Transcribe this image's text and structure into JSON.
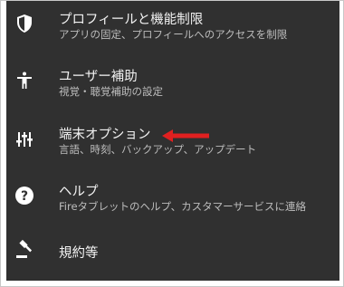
{
  "settings_list": {
    "items": [
      {
        "icon": "shield-icon",
        "title": "プロフィールと機能制限",
        "subtitle": "アプリの固定、プロフィールへのアクセスを制限"
      },
      {
        "icon": "accessibility-icon",
        "title": "ユーザー補助",
        "subtitle": "視覚・聴覚補助の設定"
      },
      {
        "icon": "sliders-icon",
        "title": "端末オプション",
        "subtitle": "言語、時刻、バックアップ、アップデート"
      },
      {
        "icon": "help-icon",
        "title": "ヘルプ",
        "subtitle": "Fireタブレットのヘルプ、カスタマーサービスに連絡"
      },
      {
        "icon": "gavel-icon",
        "title": "規約等"
      }
    ]
  },
  "annotation": {
    "icon": "red-arrow-icon",
    "color": "#e02020"
  },
  "colors": {
    "background": "#303030",
    "title": "#f2f2f2",
    "subtitle": "#bdbdbd"
  }
}
